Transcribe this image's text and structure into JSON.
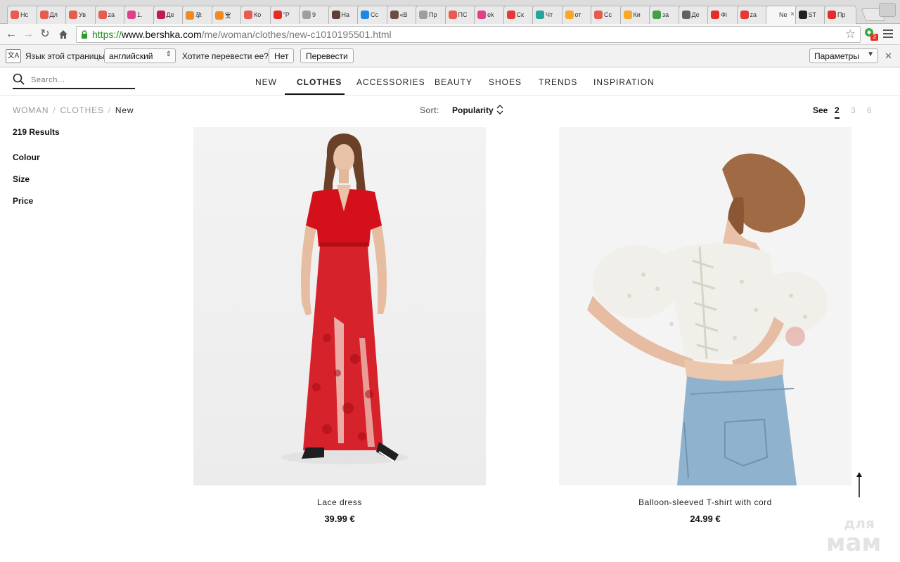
{
  "browser": {
    "tabs": [
      {
        "label": "Нс",
        "color": "#e65c4f"
      },
      {
        "label": "Дл",
        "color": "#e65c4f"
      },
      {
        "label": "Ув",
        "color": "#e65c4f"
      },
      {
        "label": "za",
        "color": "#e65c4f"
      },
      {
        "label": "1.",
        "color": "#e0408a"
      },
      {
        "label": "Де",
        "color": "#c2185b"
      },
      {
        "label": "孕",
        "color": "#f08a24"
      },
      {
        "label": "宝",
        "color": "#f08a24"
      },
      {
        "label": "Ко",
        "color": "#e65c4f"
      },
      {
        "label": "\"Р",
        "color": "#e52d27"
      },
      {
        "label": "9",
        "color": "#9e9e9e"
      },
      {
        "label": "На",
        "color": "#5d4037"
      },
      {
        "label": "Сс",
        "color": "#1e88e5"
      },
      {
        "label": "«В",
        "color": "#6d4c41"
      },
      {
        "label": "Пр",
        "color": "#9e9e9e"
      },
      {
        "label": "ПС",
        "color": "#e65c4f"
      },
      {
        "label": "ek",
        "color": "#e0408a"
      },
      {
        "label": "Ск",
        "color": "#e53935"
      },
      {
        "label": "Чт",
        "color": "#26a69a"
      },
      {
        "label": "от",
        "color": "#f9a825"
      },
      {
        "label": "Сс",
        "color": "#e65c4f"
      },
      {
        "label": "Ки",
        "color": "#f9a825"
      },
      {
        "label": "за",
        "color": "#43a047"
      },
      {
        "label": "Де",
        "color": "#616161"
      },
      {
        "label": "Фі",
        "color": "#e52d27"
      },
      {
        "label": "za",
        "color": "#e53935"
      },
      {
        "label": "Ne",
        "color": "#f6f6f6",
        "active": true
      },
      {
        "label": "ST",
        "color": "#212121"
      },
      {
        "label": "Пр",
        "color": "#e52d27"
      }
    ],
    "url": {
      "protocol": "https://",
      "host": "www.bershka.com",
      "path": "/me/woman/clothes/new-c1010195501.html"
    },
    "extension_badge": "3"
  },
  "translate_bar": {
    "prompt": "Язык этой страницы",
    "language": "английский",
    "question": "Хотите перевести ее?",
    "no_button": "Нет",
    "translate_button": "Перевести",
    "options_button": "Параметры"
  },
  "site": {
    "search_placeholder": "Search...",
    "nav": [
      {
        "label": "NEW"
      },
      {
        "label": "CLOTHES",
        "active": true
      },
      {
        "label": "ACCESSORIES"
      },
      {
        "label": "BEAUTY"
      },
      {
        "label": "SHOES"
      },
      {
        "label": "TRENDS"
      },
      {
        "label": "INSPIRATION"
      }
    ],
    "breadcrumb": [
      "WOMAN",
      "CLOTHES",
      "New"
    ],
    "sort_label": "Sort:",
    "sort_value": "Popularity",
    "see_label": "See",
    "see_options": [
      "2",
      "3",
      "6"
    ],
    "see_selected": "2",
    "results": "219 Results",
    "filters": [
      "Colour",
      "Size",
      "Price"
    ],
    "products": [
      {
        "name": "Lace dress",
        "price": "39.99 €"
      },
      {
        "name": "Balloon-sleeved T-shirt with cord",
        "price": "24.99 €"
      }
    ],
    "watermark": [
      "для",
      "мам"
    ],
    "colors": {
      "dress_red": "#d4101a",
      "denim": "#8fb3cf",
      "eyelet_white": "#f1efe9"
    }
  }
}
